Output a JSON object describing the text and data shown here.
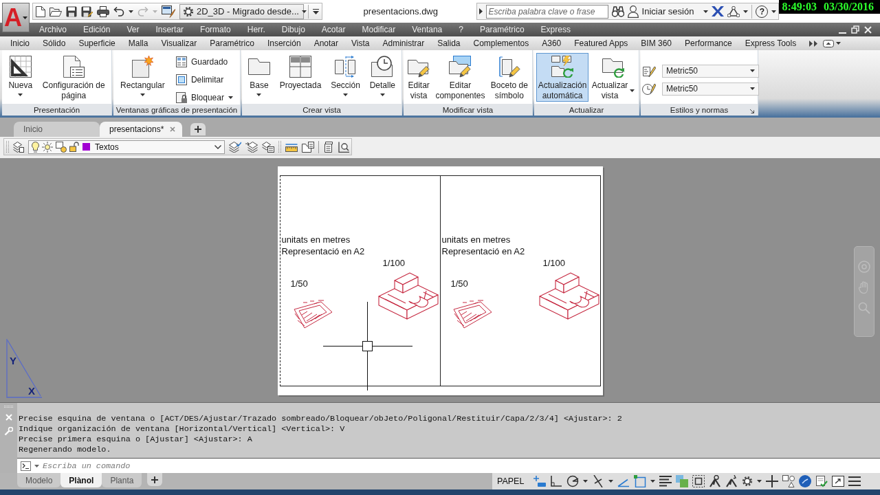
{
  "title_bar": {
    "app_button": {
      "label": "A"
    },
    "quick_access": {
      "undo": {
        "disabled": false
      },
      "redo": {
        "disabled": true
      },
      "workspace": "2D_3D - Migrado desde..."
    },
    "title": "presentacions.dwg",
    "search": {
      "placeholder": "Escriba palabra clave o frase"
    },
    "sign_in": "Iniciar sesión",
    "help": "?",
    "clock": {
      "time": "8:49:03",
      "date": "03/30/2016"
    }
  },
  "menu_bar": [
    "Archivo",
    "Edición",
    "Ver",
    "Insertar",
    "Formato",
    "Herr.",
    "Dibujo",
    "Acotar",
    "Modificar",
    "Ventana",
    "?",
    "Paramétrico",
    "Express"
  ],
  "ribbon_tabs": [
    "Inicio",
    "Sólido",
    "Superficie",
    "Malla",
    "Visualizar",
    "Paramétrico",
    "Inserción",
    "Anotar",
    "Vista",
    "Administrar",
    "Salida",
    "Complementos",
    "A360",
    "Featured Apps",
    "BIM 360",
    "Performance",
    "Express Tools"
  ],
  "ribbon": {
    "panels": [
      {
        "title": "Presentación",
        "launcher": false,
        "tools": [
          {
            "kind": "large",
            "label": "Nueva",
            "dropdown": true,
            "active": false
          },
          {
            "kind": "large",
            "label": "Configuración de\npágina",
            "dropdown": false,
            "active": false
          }
        ]
      },
      {
        "title": "Ventanas gráficas de presentación",
        "launcher": false,
        "tools": [
          {
            "kind": "large",
            "label": "Rectangular",
            "dropdown": true,
            "active": false
          },
          {
            "kind": "small",
            "label": "Guardado",
            "dropdown": false,
            "active": false
          },
          {
            "kind": "small",
            "label": "Delimitar",
            "dropdown": false,
            "active": false
          },
          {
            "kind": "small",
            "label": "Bloquear",
            "dropdown": true,
            "active": false
          }
        ]
      },
      {
        "title": "Crear vista",
        "launcher": false,
        "tools": [
          {
            "kind": "large",
            "label": "Base",
            "dropdown": true,
            "active": false
          },
          {
            "kind": "large",
            "label": "Proyectada",
            "dropdown": false,
            "active": false
          },
          {
            "kind": "large",
            "label": "Sección",
            "dropdown": true,
            "active": false
          },
          {
            "kind": "large",
            "label": "Detalle",
            "dropdown": true,
            "active": false
          }
        ]
      },
      {
        "title": "Modificar vista",
        "launcher": false,
        "tools": [
          {
            "kind": "large",
            "label": "Editar\nvista",
            "dropdown": false,
            "active": false
          },
          {
            "kind": "large",
            "label": "Editar\ncomponentes",
            "dropdown": false,
            "active": false
          },
          {
            "kind": "large",
            "label": "Boceto de\nsímbolo",
            "dropdown": false,
            "active": false
          }
        ]
      },
      {
        "title": "Actualizar",
        "launcher": false,
        "tools": [
          {
            "kind": "large",
            "label": "Actualización\nautomática",
            "dropdown": false,
            "active": true
          },
          {
            "kind": "large",
            "label": "Actualizar\nvista",
            "dropdown": true,
            "active": false
          }
        ]
      },
      {
        "title": "Estilos y normas",
        "launcher": true,
        "tools": [
          {
            "kind": "combo",
            "value": "Metric50"
          },
          {
            "kind": "combo",
            "value": "Metric50"
          }
        ]
      }
    ]
  },
  "file_tabs": [
    {
      "label": "Inicio",
      "selected": false,
      "closable": false
    },
    {
      "label": "presentacions*",
      "selected": true,
      "closable": true
    }
  ],
  "layer_toolbar": {
    "layer": {
      "name": "Textos",
      "color": "#a100d2"
    }
  },
  "paper": {
    "viewports": [
      {
        "notes": [
          "unitats en metres",
          "Representació en A2"
        ],
        "scale_small": "1/50",
        "scale_large": "1/100"
      },
      {
        "notes": [
          "unitats en metres",
          "Representació en A2"
        ],
        "scale_small": "1/50",
        "scale_large": "1/100"
      }
    ]
  },
  "ucs_icon": {
    "x_label": "X",
    "y_label": "Y"
  },
  "command_line": {
    "history": [
      "Precise esquina de ventana o [ACT/DES/Ajustar/Trazado sombreado/Bloquear/obJeto/Poligonal/Restituir/Capa/2/3/4] <Ajustar>: 2",
      "Indique organización de ventana [Horizontal/Vertical] <Vertical>: V",
      "Precise primera esquina o [Ajustar] <Ajustar>: A",
      "Regenerando modelo."
    ],
    "input": {
      "placeholder": "Escriba un comando"
    }
  },
  "layout_tabs": [
    {
      "label": "Modelo",
      "selected": false
    },
    {
      "label": "Plànol",
      "selected": true
    },
    {
      "label": "Planta",
      "selected": false
    }
  ],
  "status_bar": {
    "space": "PAPEL"
  }
}
